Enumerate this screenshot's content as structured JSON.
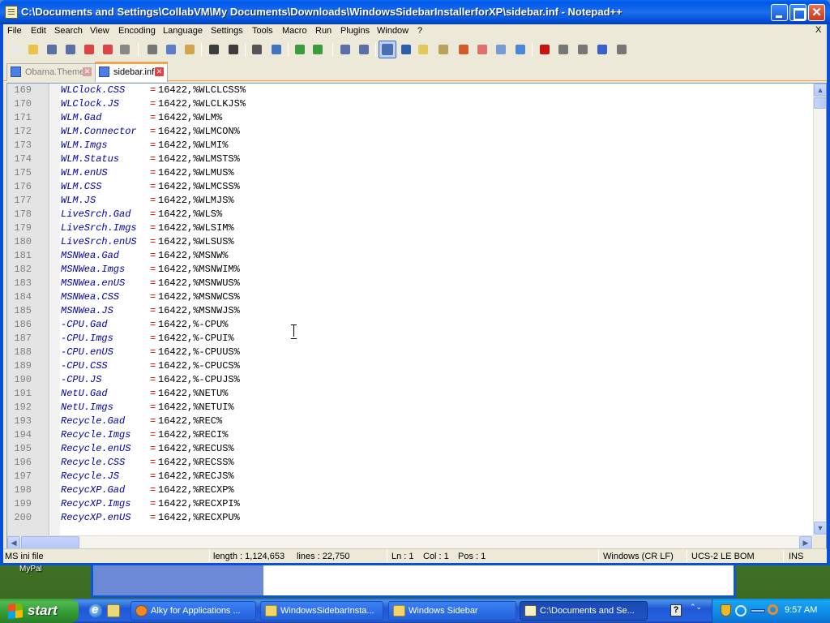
{
  "window": {
    "title": "C:\\Documents and Settings\\CollabVM\\My Documents\\Downloads\\WindowsSidebarInstallerforXP\\sidebar.inf - Notepad++",
    "close_glyph": "✕"
  },
  "menubar": {
    "items": [
      "File",
      "Edit",
      "Search",
      "View",
      "Encoding",
      "Language",
      "Settings",
      "Tools",
      "Macro",
      "Run",
      "Plugins",
      "Window",
      "?"
    ],
    "close": "X"
  },
  "toolbar": {
    "buttons": [
      "new-icon",
      "open-icon",
      "save-icon",
      "save-all-icon",
      "close-icon",
      "close-all-icon",
      "print-icon",
      "cut-icon",
      "copy-icon",
      "paste-icon",
      "undo-icon",
      "redo-icon",
      "find-icon",
      "replace-icon",
      "zoom-in-icon",
      "zoom-out-icon",
      "sync-vertical-icon",
      "sync-horizontal-icon",
      "word-wrap-icon",
      "show-all-chars-icon",
      "indent-guide-icon",
      "doc-map-icon",
      "function-list-icon",
      "folder-workspace-icon",
      "doc-switcher-icon",
      "monitoring-icon",
      "record-macro-icon",
      "stop-macro-icon",
      "play-macro-icon",
      "run-macro-multiple-icon",
      "save-macro-icon"
    ],
    "colors": {
      "accent": "#316ac5",
      "pressed_bg": "#c1d2ee"
    }
  },
  "tabs": [
    {
      "label": "Obama.Theme",
      "active": false
    },
    {
      "label": "sidebar.inf",
      "active": true
    }
  ],
  "editor": {
    "colors": {
      "key": "#0000a8",
      "equals": "#d00000",
      "value": "#000000",
      "line_number": "#808080"
    },
    "lines": [
      {
        "n": "169",
        "key": "WLClock.CSS",
        "eq": "=",
        "val": "16422,%WLCLCSS%"
      },
      {
        "n": "170",
        "key": "WLClock.JS",
        "eq": "=",
        "val": "16422,%WLCLKJS%"
      },
      {
        "n": "171",
        "key": "WLM.Gad",
        "eq": "=",
        "val": "16422,%WLM%"
      },
      {
        "n": "172",
        "key": "WLM.Connector",
        "eq": "=",
        "val": "16422,%WLMCON%"
      },
      {
        "n": "173",
        "key": "WLM.Imgs",
        "eq": "=",
        "val": "16422,%WLMI%"
      },
      {
        "n": "174",
        "key": "WLM.Status",
        "eq": "=",
        "val": "16422,%WLMSTS%"
      },
      {
        "n": "175",
        "key": "WLM.enUS",
        "eq": "=",
        "val": "16422,%WLMUS%"
      },
      {
        "n": "176",
        "key": "WLM.CSS",
        "eq": "=",
        "val": "16422,%WLMCSS%"
      },
      {
        "n": "177",
        "key": "WLM.JS",
        "eq": "=",
        "val": "16422,%WLMJS%"
      },
      {
        "n": "178",
        "key": "LiveSrch.Gad",
        "eq": "=",
        "val": "16422,%WLS%"
      },
      {
        "n": "179",
        "key": "LiveSrch.Imgs",
        "eq": "=",
        "val": "16422,%WLSIM%"
      },
      {
        "n": "180",
        "key": "LiveSrch.enUS",
        "eq": "=",
        "val": "16422,%WLSUS%"
      },
      {
        "n": "181",
        "key": "MSNWea.Gad",
        "eq": "=",
        "val": "16422,%MSNW%"
      },
      {
        "n": "182",
        "key": "MSNWea.Imgs",
        "eq": "=",
        "val": "16422,%MSNWIM%"
      },
      {
        "n": "183",
        "key": "MSNWea.enUS",
        "eq": "=",
        "val": "16422,%MSNWUS%"
      },
      {
        "n": "184",
        "key": "MSNWea.CSS",
        "eq": "=",
        "val": "16422,%MSNWCS%"
      },
      {
        "n": "185",
        "key": "MSNWea.JS",
        "eq": "=",
        "val": "16422,%MSNWJS%"
      },
      {
        "n": "186",
        "key": "-CPU.Gad",
        "eq": "=",
        "val": "16422,%-CPU%"
      },
      {
        "n": "187",
        "key": "-CPU.Imgs",
        "eq": "=",
        "val": "16422,%-CPUI%"
      },
      {
        "n": "188",
        "key": "-CPU.enUS",
        "eq": "=",
        "val": "16422,%-CPUUS%"
      },
      {
        "n": "189",
        "key": "-CPU.CSS",
        "eq": "=",
        "val": "16422,%-CPUCS%"
      },
      {
        "n": "190",
        "key": "-CPU.JS",
        "eq": "=",
        "val": "16422,%-CPUJS%"
      },
      {
        "n": "191",
        "key": "NetU.Gad",
        "eq": "=",
        "val": "16422,%NETU%"
      },
      {
        "n": "192",
        "key": "NetU.Imgs",
        "eq": "=",
        "val": "16422,%NETUI%"
      },
      {
        "n": "193",
        "key": "Recycle.Gad",
        "eq": "=",
        "val": "16422,%REC%"
      },
      {
        "n": "194",
        "key": "Recycle.Imgs",
        "eq": "=",
        "val": "16422,%RECI%"
      },
      {
        "n": "195",
        "key": "Recycle.enUS",
        "eq": "=",
        "val": "16422,%RECUS%"
      },
      {
        "n": "196",
        "key": "Recycle.CSS",
        "eq": "=",
        "val": "16422,%RECSS%"
      },
      {
        "n": "197",
        "key": "Recycle.JS",
        "eq": "=",
        "val": "16422,%RECJS%"
      },
      {
        "n": "198",
        "key": "RecycXP.Gad",
        "eq": "=",
        "val": "16422,%RECXP%"
      },
      {
        "n": "199",
        "key": "RecycXP.Imgs",
        "eq": "=",
        "val": "16422,%RECXPI%"
      },
      {
        "n": "200",
        "key": "RecycXP.enUS",
        "eq": "=",
        "val": "16422,%RECXPU%"
      }
    ]
  },
  "statusbar": {
    "file_type": "MS ini file",
    "length": "length : 1,124,653",
    "lines": "lines : 22,750",
    "ln": "Ln : 1",
    "col": "Col : 1",
    "pos": "Pos : 1",
    "eol": "Windows (CR LF)",
    "encoding": "UCS-2 LE BOM",
    "mode": "INS"
  },
  "desktop": {
    "icon_label": "MyPal"
  },
  "taskbar": {
    "start_label": "start",
    "tasks": [
      {
        "label": "Alky for Applications ...",
        "active": false
      },
      {
        "label": "WindowsSidebarInsta...",
        "active": false
      },
      {
        "label": "Windows Sidebar",
        "active": false
      },
      {
        "label": "C:\\Documents and Se...",
        "active": true
      }
    ],
    "help": "?",
    "chevron": "⌃⌄",
    "clock": "9:57 AM"
  }
}
